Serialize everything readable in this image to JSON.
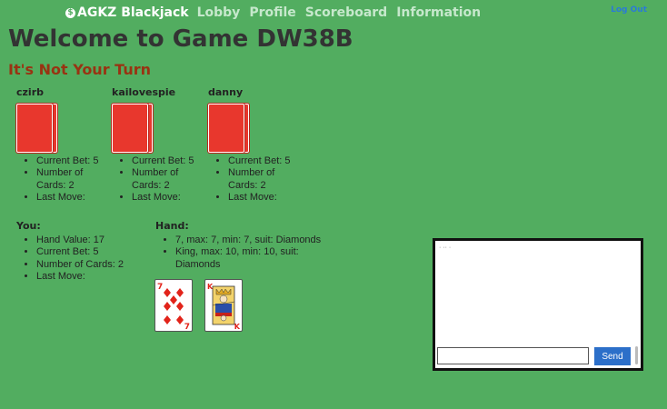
{
  "nav": {
    "brand": "AGKZ Blackjack",
    "brand_icon": "$",
    "links": [
      "Lobby",
      "Profile",
      "Scoreboard",
      "Information"
    ],
    "logout": "Log Out"
  },
  "page": {
    "title": "Welcome to Game DW38B",
    "turn_status": "It's Not Your Turn"
  },
  "players": [
    {
      "name": "czirb",
      "bet": "Current Bet: 5",
      "cards": "Number of Cards: 2",
      "last_move": "Last Move:"
    },
    {
      "name": "kailovespie",
      "bet": "Current Bet: 5",
      "cards": "Number of Cards: 2",
      "last_move": "Last Move:"
    },
    {
      "name": "danny",
      "bet": "Current Bet: 5",
      "cards": "Number of Cards: 2",
      "last_move": "Last Move:"
    }
  ],
  "you": {
    "heading": "You:",
    "hand_value": "Hand Value: 17",
    "bet": "Current Bet: 5",
    "cards": "Number of Cards: 2",
    "last_move": "Last Move:"
  },
  "hand": {
    "heading": "Hand:",
    "items": [
      "7, max: 7, min: 7, suit: Diamonds",
      "King, max: 10, min: 10, suit: Diamonds"
    ],
    "cards": [
      {
        "rank": "7",
        "suit_symbol": "♦"
      },
      {
        "rank": "K",
        "suit_symbol": "♦"
      }
    ]
  },
  "chat": {
    "log_text": "· ·· ·",
    "input_value": "",
    "send_label": "Send"
  },
  "colors": {
    "background": "#52ad60",
    "card_back": "#e8372d",
    "diamond": "#e2231a",
    "send": "#2c6fc9",
    "turn_text": "#993312"
  }
}
